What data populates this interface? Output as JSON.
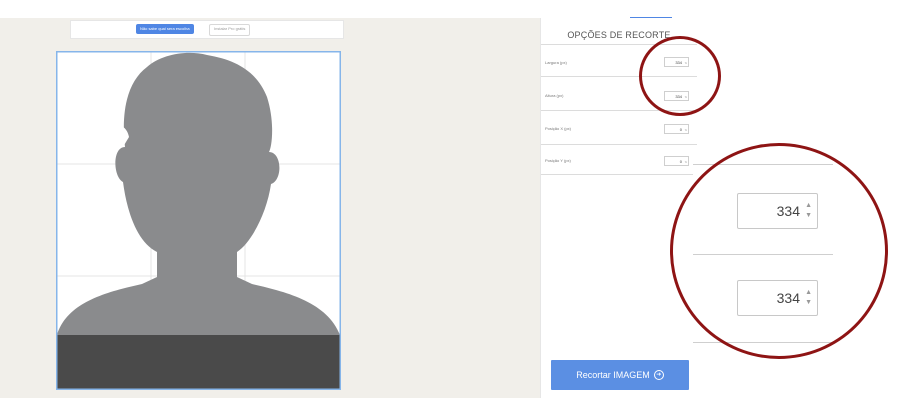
{
  "toolbar": {
    "primary_label": "Não sabe qual sera escolha",
    "secondary_label": "Instalar Pro grátis"
  },
  "panel": {
    "title": "OPÇÕES DE RECORTE",
    "fields": [
      {
        "label": "Largura (px)",
        "value": "334"
      },
      {
        "label": "Altura (px)",
        "value": "334"
      },
      {
        "label": "Posição X (px)",
        "value": "0"
      },
      {
        "label": "Posição Y (px)",
        "value": "0"
      }
    ],
    "crop_button_label": "Recortar IMAGEM",
    "crop_button_icon": "arrow-circle-icon"
  },
  "zoom": {
    "width_value": "334",
    "height_value": "334"
  },
  "colors": {
    "accent": "#5b8fe3",
    "annotation": "#8e1414",
    "silhouette": "#8a8b8d",
    "dark_band": "#4a4a4a"
  }
}
